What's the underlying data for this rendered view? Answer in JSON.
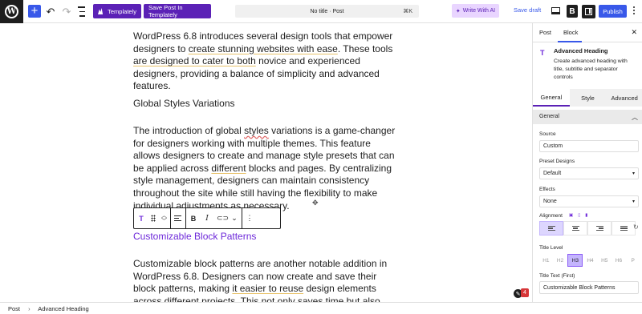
{
  "topbar": {
    "logo_glyph": "W",
    "templately_label": "Templately",
    "save_templately_label": "Save Post In Templately",
    "doc_title": "No title · Post",
    "doc_shortcut": "⌘K",
    "write_ai_label": "Write With AI",
    "save_draft_label": "Save draft",
    "brand_letter": "B",
    "publish_label": "Publish"
  },
  "content": {
    "para1": {
      "a": "WordPress 6.8 introduces several design tools that empower designers to ",
      "u1": "create stunning websites with ease",
      "b": ". These tools ",
      "u2": "are designed to cater to both",
      "c": " novice and experienced designers, providing a balance of simplicity and advanced features."
    },
    "heading1": "Global Styles Variations",
    "para2": {
      "a": "The introduction of global ",
      "u1": "styles",
      "b": " variations is a game-changer for designers working with multiple themes. This feature allows designers to create and manage style presets that can be applied across ",
      "u2": "different",
      "c": " blocks and pages. By centralizing style management, designers can maintain consistency throughout the site while still having the flexibility to make individual adjustments as necessary."
    },
    "heading2": "Customizable Block Patterns",
    "para3": {
      "a": "Customizable block patterns are another notable addition in WordPress 6.8. Designers can now create and save their block patterns, making ",
      "u1": "it easier to reuse",
      "b": " design elements across different projects. This not only saves time but also allows for a"
    }
  },
  "sidebar": {
    "tab_post": "Post",
    "tab_block": "Block",
    "block_name": "Advanced Heading",
    "block_desc": "Create advanced heading with title, subtitle and separator controls",
    "ctrl_tabs": [
      "General",
      "Style",
      "Advanced"
    ],
    "section_title": "General",
    "source_label": "Source",
    "source_value": "Custom",
    "preset_label": "Preset Designs",
    "preset_value": "Default",
    "effects_label": "Effects",
    "effects_value": "None",
    "alignment_label": "Alignment",
    "title_level_label": "Title Level",
    "levels": [
      "H1",
      "H2",
      "H3",
      "H4",
      "H5",
      "H6",
      "P"
    ],
    "active_level": "H3",
    "title_text_label": "Title Text (First)",
    "title_text_value": "Customizable Block Patterns"
  },
  "notifications": {
    "count": "4"
  },
  "footer": {
    "crumb1": "Post",
    "separator": "›",
    "crumb2": "Advanced Heading"
  },
  "colors": {
    "accent_blue": "#3858e9",
    "templately_purple": "#5b21b6",
    "heading_purple": "#6d28d9"
  }
}
